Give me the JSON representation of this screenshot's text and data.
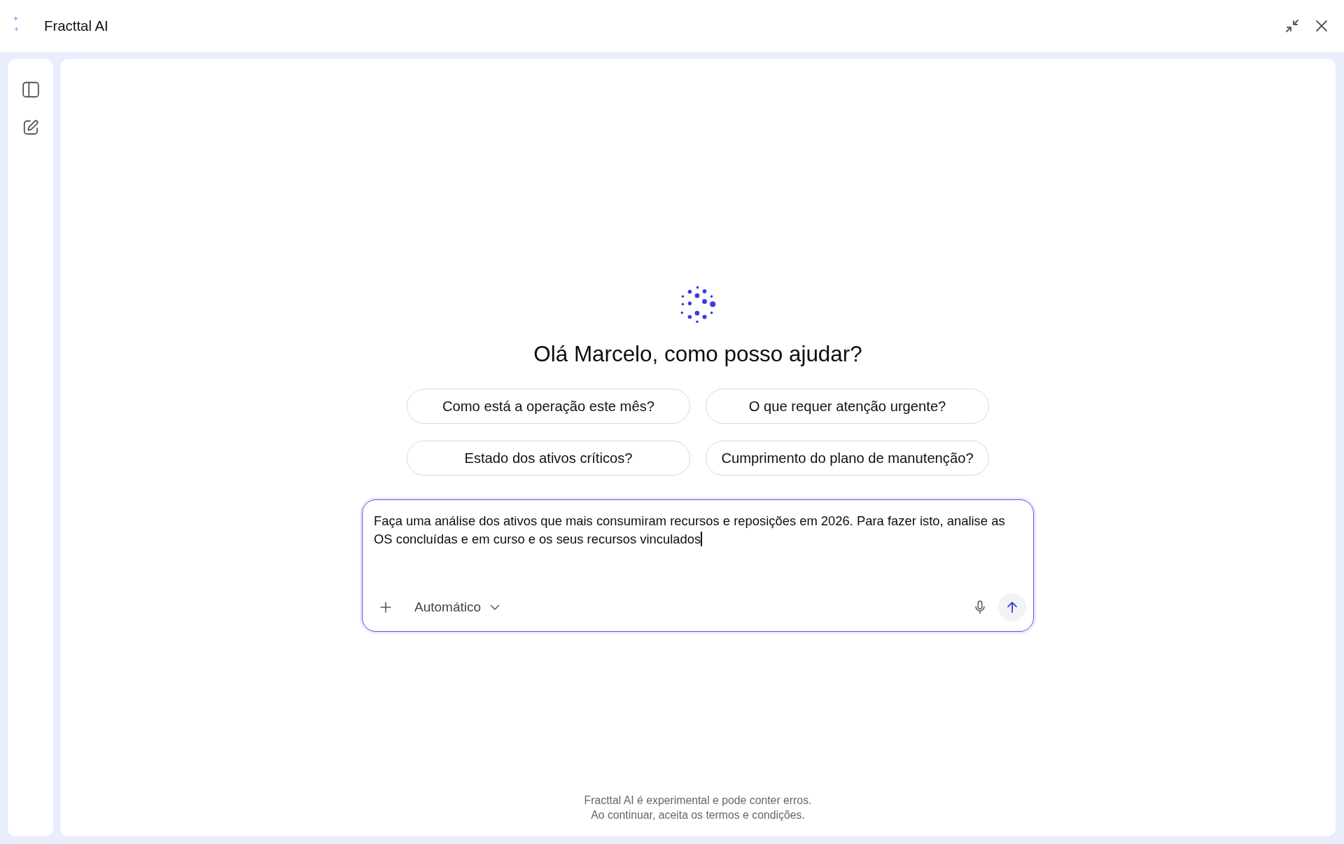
{
  "window": {
    "title": "Fracttal AI"
  },
  "greeting": "Olá Marcelo, como posso ajudar?",
  "suggestions": [
    "Como está a operação este mês?",
    "O que requer atenção urgente?",
    "Estado dos ativos críticos?",
    "Cumprimento do plano de manutenção?"
  ],
  "composer": {
    "value": "Faça uma análise dos ativos que mais consumiram recursos e reposições em 2026. Para fazer isto, analise as OS concluídas e em curso e os seus recursos vinculados",
    "focused": true,
    "mode": "Automático"
  },
  "footer": [
    "Fracttal AI é experimental e pode conter erros.",
    "Ao continuar, aceita os termos e condições."
  ]
}
